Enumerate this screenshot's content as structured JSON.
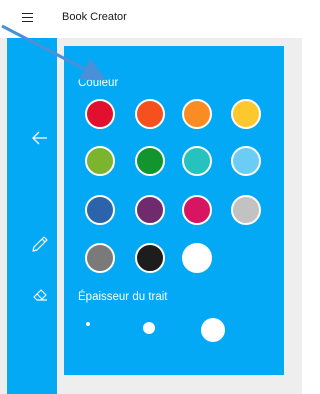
{
  "app": {
    "title": "Book Creator"
  },
  "panel": {
    "color_label": "Couleur",
    "thickness_label": "Épaisseur du trait",
    "colors": [
      {
        "name": "red",
        "hex": "#e2102f"
      },
      {
        "name": "orange-red",
        "hex": "#f4511e"
      },
      {
        "name": "orange",
        "hex": "#fb8c23"
      },
      {
        "name": "yellow",
        "hex": "#fdc72e"
      },
      {
        "name": "yellow-green",
        "hex": "#7cb52d"
      },
      {
        "name": "green",
        "hex": "#12952f"
      },
      {
        "name": "teal",
        "hex": "#26c2bd"
      },
      {
        "name": "light-blue",
        "hex": "#6bcdf5"
      },
      {
        "name": "blue",
        "hex": "#2b64ab"
      },
      {
        "name": "purple",
        "hex": "#6f2b6e"
      },
      {
        "name": "pink",
        "hex": "#d81563"
      },
      {
        "name": "light-gray",
        "hex": "#c2c2c2"
      },
      {
        "name": "gray",
        "hex": "#7a7a7a"
      },
      {
        "name": "black",
        "hex": "#1d1d1d"
      },
      {
        "name": "white",
        "hex": "#ffffff"
      }
    ],
    "thickness_options": [
      "small",
      "medium",
      "large"
    ]
  },
  "sidebar": {
    "icons": [
      "back-arrow-icon",
      "pencil-icon",
      "eraser-icon"
    ]
  },
  "theme": {
    "accent": "#03a9f4",
    "background": "#eeeeee"
  }
}
